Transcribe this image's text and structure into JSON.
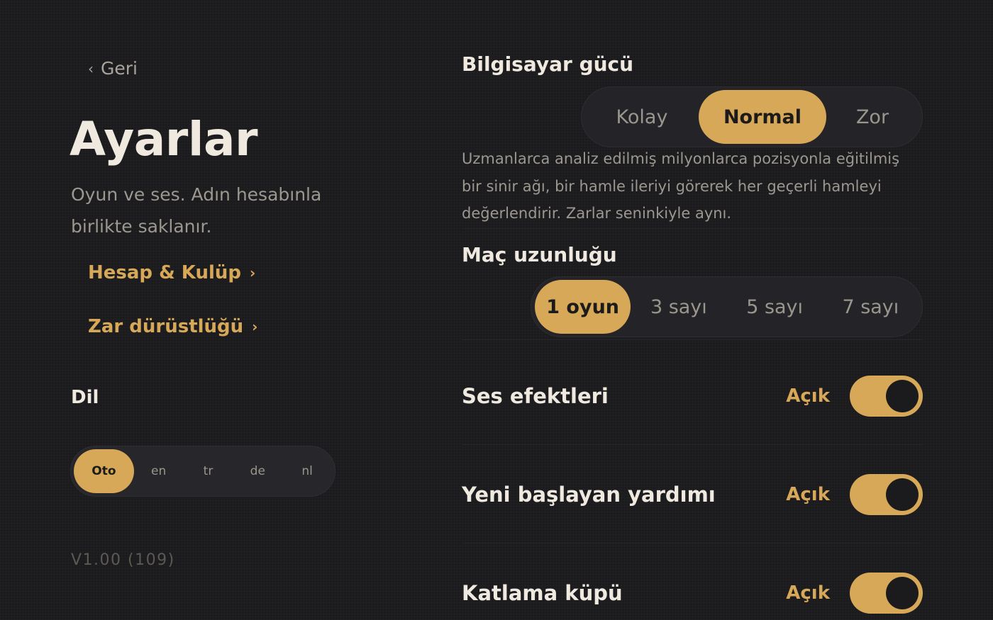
{
  "back": {
    "label": "Geri"
  },
  "page": {
    "title": "Ayarlar",
    "subtitle": "Oyun ve ses. Adın hesabınla birlikte saklanır."
  },
  "links": {
    "account": "Hesap & Kulüp",
    "dice": "Zar dürüstlüğü"
  },
  "language": {
    "label": "Dil",
    "options": [
      "Oto",
      "en",
      "tr",
      "de",
      "nl"
    ],
    "selected": "Oto"
  },
  "version": "V1.00 (109)",
  "strength": {
    "title": "Bilgisayar gücü",
    "options": [
      "Kolay",
      "Normal",
      "Zor"
    ],
    "selected": "Normal",
    "description": "Uzmanlarca analiz edilmiş milyonlarca pozisyonla eğitilmiş bir sinir ağı, bir hamle ileriyi görerek her geçerli hamleyi değerlendirir. Zarlar seninkiyle aynı."
  },
  "match_length": {
    "title": "Maç uzunluğu",
    "options": [
      "1 oyun",
      "3 sayı",
      "5 sayı",
      "7 sayı"
    ],
    "selected": "1 oyun"
  },
  "toggles": {
    "sound_effects": {
      "label": "Ses efektleri",
      "state": "Açık",
      "on": true
    },
    "beginner_help": {
      "label": "Yeni başlayan yardımı",
      "state": "Açık",
      "on": true
    },
    "doubling_cube": {
      "label": "Katlama küpü",
      "state": "Açık",
      "on": true
    }
  },
  "colors": {
    "accent": "#d6a857",
    "background": "#1b1b1e",
    "text": "#efe9df",
    "muted": "#9c978f"
  }
}
